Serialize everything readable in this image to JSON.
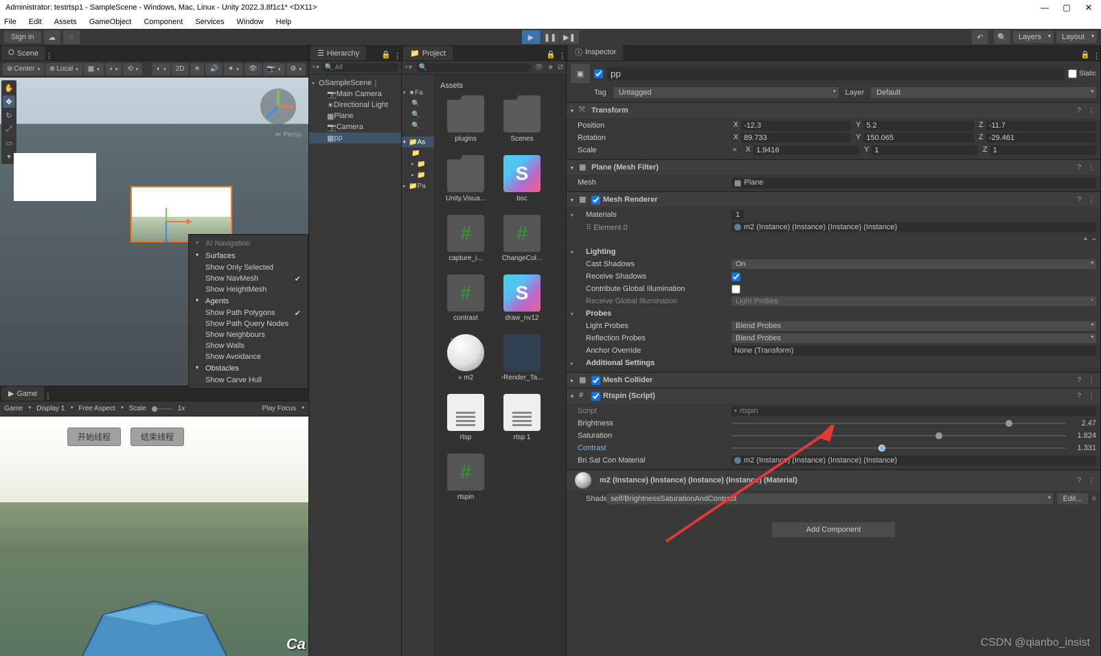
{
  "window": {
    "title": "Administrator: testrtsp1 - SampleScene - Windows, Mac, Linux - Unity 2022.3.8f1c1* <DX11>"
  },
  "menu": [
    "File",
    "Edit",
    "Assets",
    "GameObject",
    "Component",
    "Services",
    "Window",
    "Help"
  ],
  "toolbar": {
    "signin": "Sign in",
    "layers": "Layers",
    "layout": "Layout"
  },
  "tabs": {
    "scene": "Scene",
    "game": "Game",
    "hierarchy": "Hierarchy",
    "project": "Project",
    "inspector": "Inspector"
  },
  "sceneToolbar": {
    "pivot": "Center",
    "local": "Local",
    "mode2d": "2D",
    "persp": "≪ Persp"
  },
  "aiNav": {
    "title": "AI Navigation",
    "surfaces": "Surfaces",
    "surfacesItems": [
      "Show Only Selected",
      "Show NavMesh",
      "Show HeightMesh"
    ],
    "agents": "Agents",
    "agentsItems": [
      "Show Path Polygons",
      "Show Path Query Nodes",
      "Show Neighbours",
      "Show Walls",
      "Show Avoidance"
    ],
    "obstacles": "Obstacles",
    "obstaclesItems": [
      "Show Carve Hull"
    ]
  },
  "gameBar": {
    "game": "Game",
    "display": "Display 1",
    "aspect": "Free Aspect",
    "scale": "Scale",
    "scaleVal": "1x",
    "play": "Play Focus"
  },
  "gameButtons": {
    "start": "开始线程",
    "end": "结束线程"
  },
  "hierarchy": {
    "search": "All",
    "root": "SampleScene",
    "items": [
      "Main Camera",
      "Directional Light",
      "Plane",
      "Camera",
      "pp"
    ]
  },
  "project": {
    "crumb": "Assets",
    "favHeader": "Fa",
    "assetsHeader": "As",
    "packagesHeader": "Pa",
    "assets": [
      {
        "name": "plugins",
        "type": "folder"
      },
      {
        "name": "Scenes",
        "type": "folder"
      },
      {
        "name": "Unity.Visua...",
        "type": "folder"
      },
      {
        "name": "bsc",
        "type": "shader"
      },
      {
        "name": "capture_i...",
        "type": "cs"
      },
      {
        "name": "ChangeCol...",
        "type": "cs"
      },
      {
        "name": "contrast",
        "type": "cs"
      },
      {
        "name": "draw_nv12",
        "type": "shader"
      },
      {
        "name": "m2",
        "type": "mat"
      },
      {
        "name": "Render_Ta...",
        "type": "render"
      },
      {
        "name": "rtsp",
        "type": "txt"
      },
      {
        "name": "rtsp 1",
        "type": "txt"
      },
      {
        "name": "rtspin",
        "type": "cs"
      }
    ]
  },
  "inspector": {
    "name": "pp",
    "static": "Static",
    "tag": "Tag",
    "tagVal": "Untagged",
    "layer": "Layer",
    "layerVal": "Default",
    "transform": {
      "title": "Transform",
      "position": {
        "label": "Position",
        "x": "-12.3",
        "y": "5.2",
        "z": "-11.7"
      },
      "rotation": {
        "label": "Rotation",
        "x": "89.733",
        "y": "150.065",
        "z": "-29.461"
      },
      "scale": {
        "label": "Scale",
        "x": "1.9416",
        "y": "1",
        "z": "1"
      }
    },
    "meshFilter": {
      "title": "Plane (Mesh Filter)",
      "meshLbl": "Mesh",
      "mesh": "Plane"
    },
    "meshRenderer": {
      "title": "Mesh Renderer",
      "materials": "Materials",
      "matCount": "1",
      "element0": "Element 0",
      "element0Val": "m2 (Instance) (Instance) (Instance) (Instance)",
      "lighting": "Lighting",
      "castShadows": "Cast Shadows",
      "castShadowsVal": "On",
      "receiveShadows": "Receive Shadows",
      "contribGI": "Contribute Global Illumination",
      "receiveGI": "Receive Global Illumination",
      "receiveGIVal": "Light Probes",
      "probes": "Probes",
      "lightProbes": "Light Probes",
      "lightProbesVal": "Blend Probes",
      "reflectionProbes": "Reflection Probes",
      "reflectionProbesVal": "Blend Probes",
      "anchorOverride": "Anchor Override",
      "anchorOverrideVal": "None (Transform)",
      "addSettings": "Additional Settings"
    },
    "meshCollider": {
      "title": "Mesh Collider"
    },
    "rtspin": {
      "title": "Rtspin (Script)",
      "script": "Script",
      "scriptVal": "rtspin",
      "brightness": "Brightness",
      "brightnessVal": "2.47",
      "saturation": "Saturation",
      "saturationVal": "1.824",
      "contrast": "Contrast",
      "contrastVal": "1.331",
      "briSatCon": "Bri Sat Con Material",
      "briSatConVal": "m2 (Instance) (Instance) (Instance) (Instance)"
    },
    "material": {
      "title": "m2 (Instance) (Instance) (Instance) (Instance) (Material)",
      "shader": "Shader",
      "shaderVal": "self/BrightnessSaturationAndContrast",
      "edit": "Edit..."
    },
    "addComponent": "Add Component"
  },
  "watermark": "CSDN @qianbo_insist"
}
